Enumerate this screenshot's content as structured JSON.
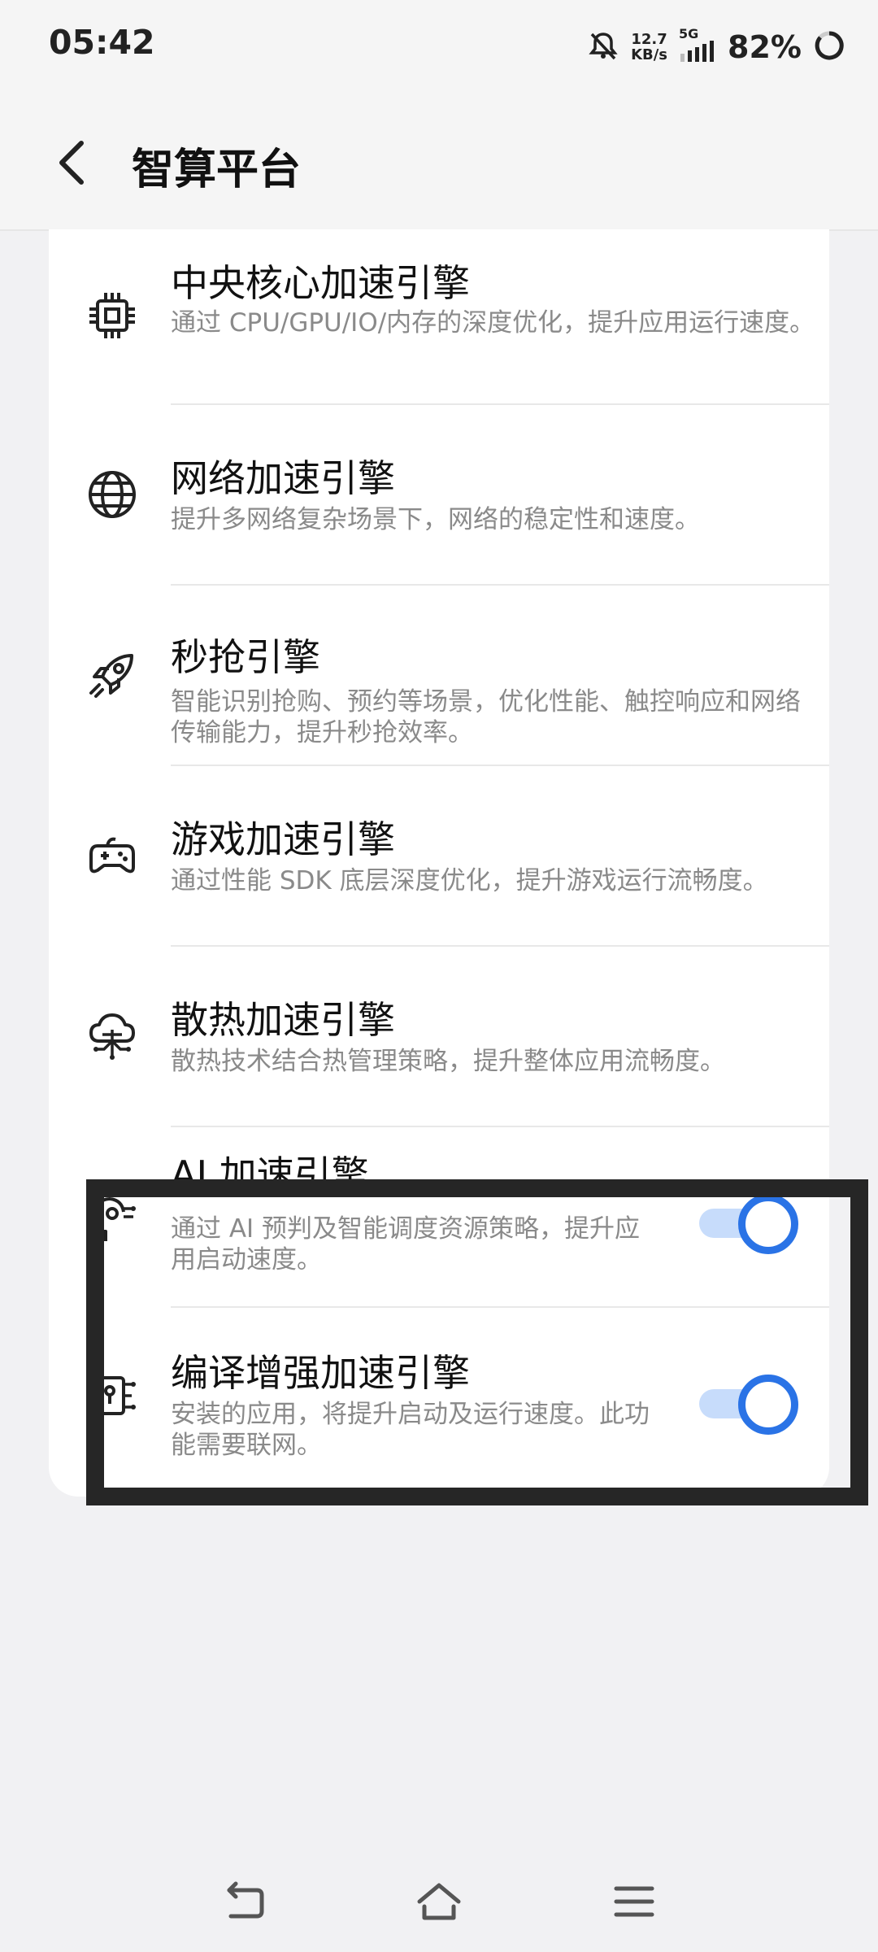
{
  "status_bar": {
    "time": "05:42",
    "net_speed_value": "12.7",
    "net_speed_unit": "KB/s",
    "network_type": "5G",
    "battery": "82%"
  },
  "header": {
    "title": "智算平台"
  },
  "items": [
    {
      "title": "中央核心加速引擎",
      "desc": "通过 CPU/GPU/IO/内存的深度优化，提升应用运行速度。",
      "icon": "chip-icon"
    },
    {
      "title": "网络加速引擎",
      "desc": "提升多网络复杂场景下，网络的稳定性和速度。",
      "icon": "globe-icon"
    },
    {
      "title": "秒抢引擎",
      "desc": "智能识别抢购、预约等场景，优化性能、触控响应和网络传输能力，提升秒抢效率。",
      "icon": "rocket-icon"
    },
    {
      "title": "游戏加速引擎",
      "desc": "通过性能 SDK 底层深度优化，提升游戏运行流畅度。",
      "icon": "gamepad-icon"
    },
    {
      "title": "散热加速引擎",
      "desc": "散热技术结合热管理策略，提升整体应用流畅度。",
      "icon": "cloud-cooling-icon"
    },
    {
      "title": "AI 加速引擎",
      "desc": "通过 AI 预判及智能调度资源策略，提升应用启动速度。",
      "icon": "ai-head-icon",
      "toggle": "on"
    },
    {
      "title": "编译增强加速引擎",
      "desc": "安装的应用，将提升启动及运行速度。此功能需要联网。",
      "icon": "compile-chip-icon",
      "toggle": "on"
    }
  ],
  "colors": {
    "accent": "#2a73e6",
    "track": "#c7dcfb",
    "highlight_border": "#262626"
  }
}
